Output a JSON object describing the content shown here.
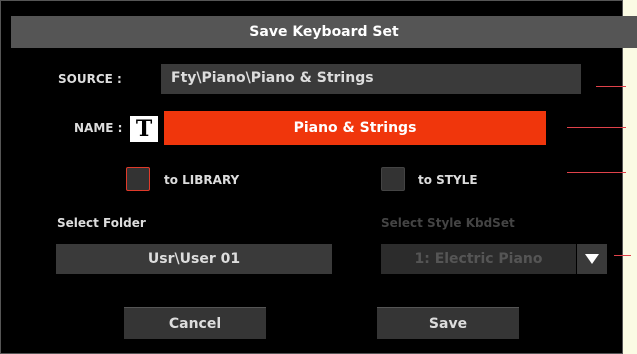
{
  "dialog": {
    "title": "Save Keyboard Set"
  },
  "source": {
    "label": "SOURCE :",
    "value": "Fty\\Piano\\Piano & Strings"
  },
  "name": {
    "label": "NAME :",
    "text_icon": "T",
    "value": "Piano & Strings"
  },
  "options": {
    "to_library_label": "to LIBRARY",
    "to_style_label": "to STYLE"
  },
  "folder": {
    "label": "Select Folder",
    "value": "Usr\\User 01"
  },
  "style_kbdset": {
    "label": "Select Style KbdSet",
    "value": "1: Electric Piano"
  },
  "buttons": {
    "cancel": "Cancel",
    "save": "Save"
  },
  "colors": {
    "accent": "#f0360c",
    "callout": "#e0424a"
  }
}
